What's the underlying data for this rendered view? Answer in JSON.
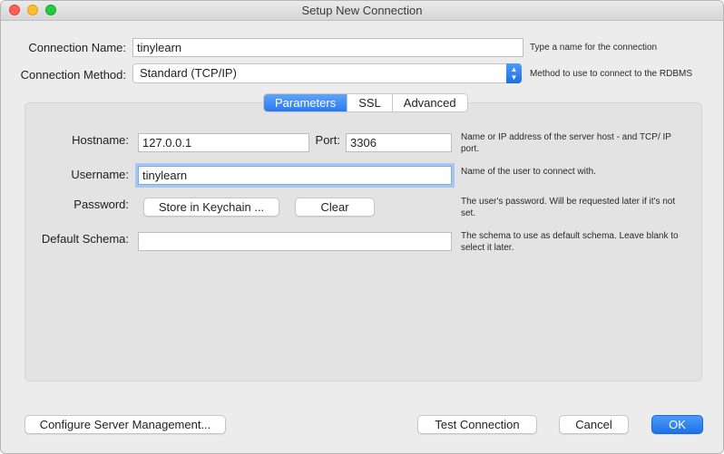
{
  "window": {
    "title": "Setup New Connection"
  },
  "connection": {
    "name_label": "Connection Name:",
    "name_value": "tinylearn",
    "name_hint": "Type a name for the connection",
    "method_label": "Connection Method:",
    "method_value": "Standard (TCP/IP)",
    "method_hint": "Method to use to connect to the RDBMS"
  },
  "tabs": [
    {
      "label": "Parameters",
      "active": true
    },
    {
      "label": "SSL",
      "active": false
    },
    {
      "label": "Advanced",
      "active": false
    }
  ],
  "parameters": {
    "hostname_label": "Hostname:",
    "hostname_value": "127.0.0.1",
    "port_label": "Port:",
    "port_value": "3306",
    "host_hint": "Name or IP address of the server host - and TCP/ IP port.",
    "username_label": "Username:",
    "username_value": "tinylearn",
    "username_hint": "Name of the user to connect with.",
    "password_label": "Password:",
    "store_keychain_label": "Store in Keychain ...",
    "clear_label": "Clear",
    "password_hint": "The user's password. Will be requested later if it's not set.",
    "schema_label": "Default Schema:",
    "schema_value": "",
    "schema_hint": "The schema to use as default schema. Leave blank to select it later."
  },
  "footer": {
    "configure_label": "Configure Server Management...",
    "test_label": "Test Connection",
    "cancel_label": "Cancel",
    "ok_label": "OK"
  },
  "colors": {
    "accent": "#2a7af0",
    "focus_ring": "#a5c8f3"
  }
}
